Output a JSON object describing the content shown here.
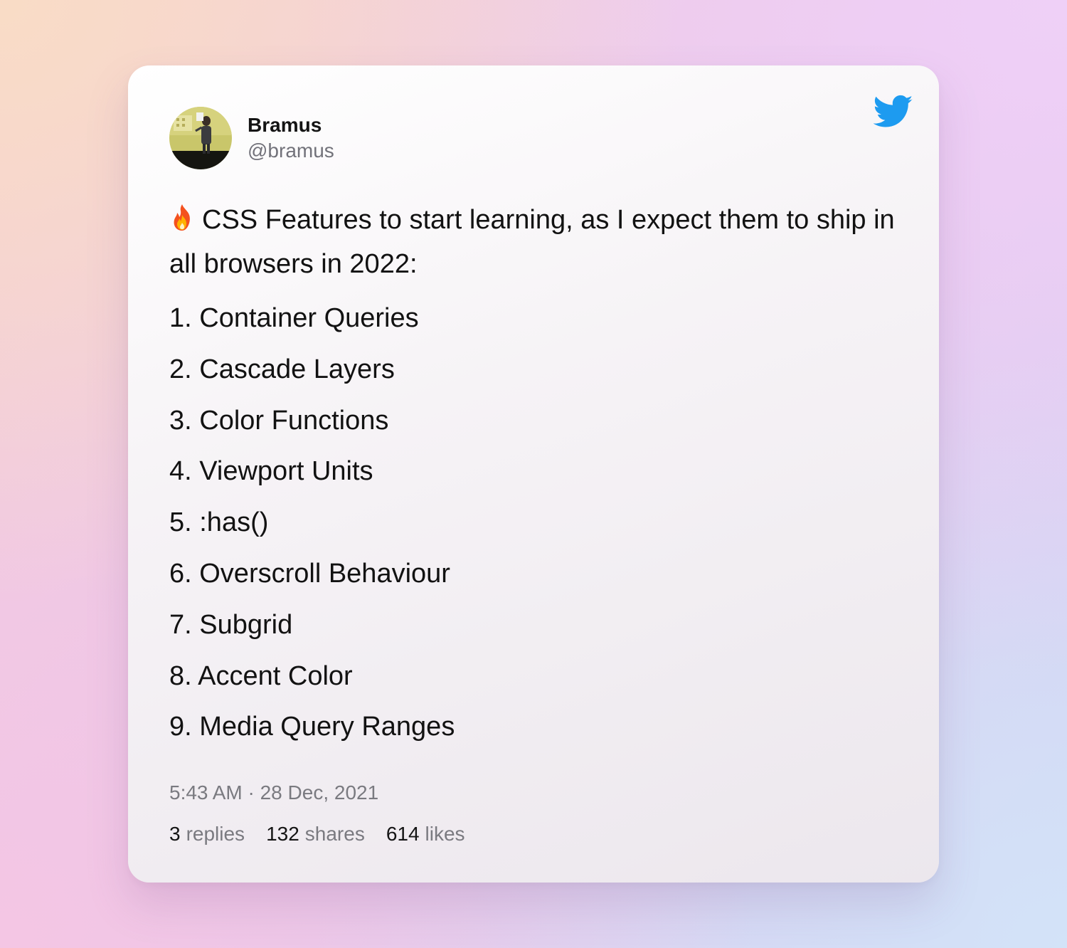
{
  "author": {
    "name": "Bramus",
    "handle": "@bramus",
    "avatar_icon": "profile-photo"
  },
  "brand": {
    "icon": "twitter-bird-icon",
    "color": "#1d9bf0"
  },
  "tweet": {
    "emoji_icon": "fire-emoji",
    "text": "CSS Features to start learning, as I expect them to ship in all browsers in 2022:",
    "items": [
      "1. Container Queries",
      "2. Cascade Layers",
      "3. Color Functions",
      "4. Viewport Units",
      "5. :has()",
      "6. Overscroll Behaviour",
      "7. Subgrid",
      "8. Accent Color",
      "9. Media Query Ranges"
    ]
  },
  "meta": {
    "timestamp": "5:43 AM · 28 Dec, 2021"
  },
  "stats": {
    "replies": {
      "count": "3",
      "label": "replies"
    },
    "shares": {
      "count": "132",
      "label": "shares"
    },
    "likes": {
      "count": "614",
      "label": "likes"
    }
  }
}
